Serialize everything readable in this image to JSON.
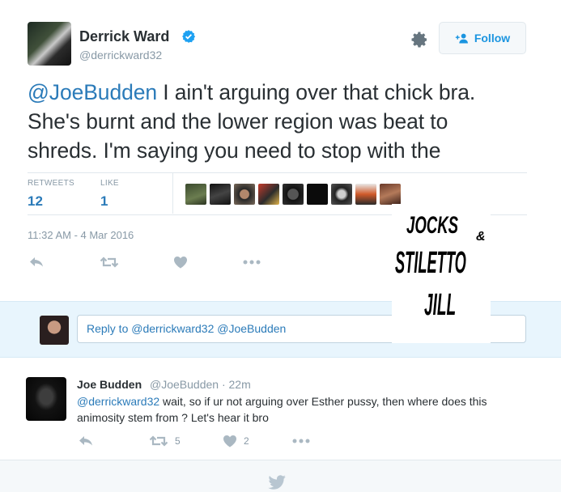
{
  "tweet": {
    "author": {
      "name": "Derrick Ward",
      "handle": "@derrickward32",
      "verified": true
    },
    "follow_label": "Follow",
    "text_mention": "@JoeBudden",
    "text_line1_rest": " I ain't arguing over that chick bra.",
    "text_line2": "She's burnt and the lower region was beat to",
    "text_line3": "shreds. I'm saying you need to stop with the",
    "stats": {
      "retweets_label": "RETWEETS",
      "retweets": "12",
      "likes_label": "LIKE",
      "likes": "1"
    },
    "timestamp": "11:32 AM - 4 Mar 2016"
  },
  "watermark": {
    "line1": "JOCKS",
    "amp": "&",
    "line2": "STILETTO",
    "line3": "JILL"
  },
  "reply_box": {
    "placeholder": "Reply to @derrickward32 @JoeBudden"
  },
  "reply": {
    "name": "Joe Budden",
    "meta": "@JoeBudden · 22m",
    "mention": "@derrickward32",
    "text": " wait, so if ur not arguing over Esther pussy, then where does this animosity stem from ? Let's hear it bro",
    "retweets": "5",
    "likes": "2"
  },
  "colors": {
    "link": "#2b7bb9",
    "muted": "#8899a6",
    "text": "#292f33",
    "verified": "#1da1f2"
  },
  "icons": [
    "verified-badge-icon",
    "gear-icon",
    "follow-person-icon",
    "reply-icon",
    "retweet-icon",
    "heart-icon",
    "more-icon",
    "twitter-bird-icon"
  ]
}
